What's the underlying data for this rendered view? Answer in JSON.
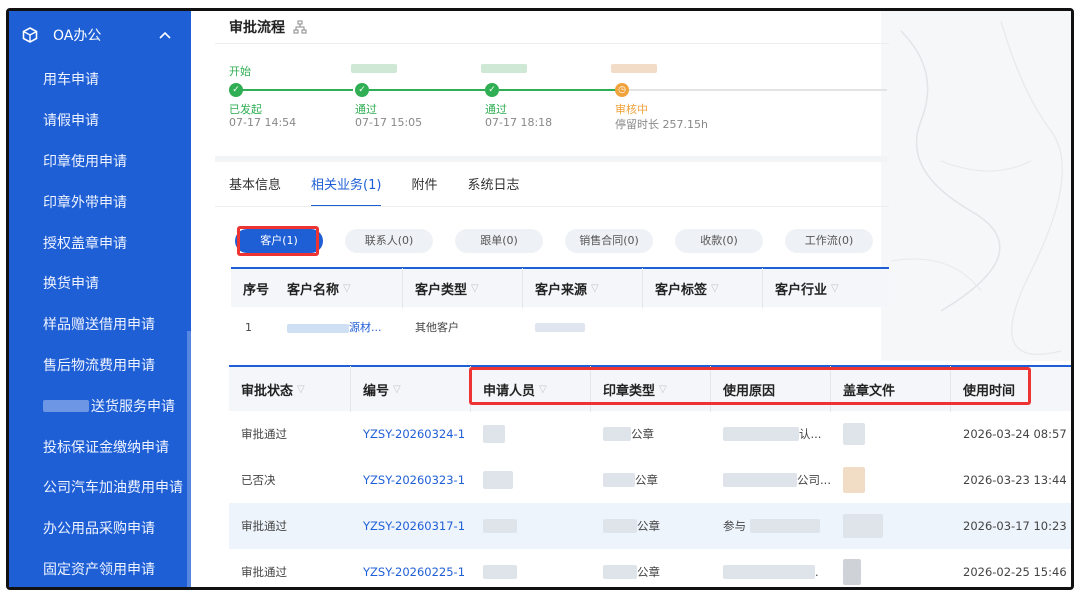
{
  "sidebar": {
    "group_title": "OA办公",
    "items": [
      {
        "label": "用车申请"
      },
      {
        "label": "请假申请"
      },
      {
        "label": "印章使用申请"
      },
      {
        "label": "印章外带申请"
      },
      {
        "label": "授权盖章申请"
      },
      {
        "label": "换货申请"
      },
      {
        "label": "样品赠送借用申请"
      },
      {
        "label": "售后物流费用申请"
      },
      {
        "label": "送货服务申请"
      },
      {
        "label": "投标保证金缴纳申请"
      },
      {
        "label": "公司汽车加油费用申请"
      },
      {
        "label": "办公用品采购申请"
      },
      {
        "label": "固定资产领用申请"
      }
    ]
  },
  "section_title": "审批流程",
  "steps": [
    {
      "top": "开始",
      "status": "已发起",
      "time": "07-17 14:54"
    },
    {
      "top": "",
      "status": "通过",
      "time": "07-17 15:05"
    },
    {
      "top": "",
      "status": "通过",
      "time": "07-17 18:18"
    },
    {
      "top": "",
      "status": "审核中",
      "time": "停留时长 257.15h"
    }
  ],
  "tabs": [
    "基本信息",
    "相关业务(1)",
    "附件",
    "系统日志"
  ],
  "pills": [
    "客户(1)",
    "联系人(0)",
    "跟单(0)",
    "销售合同(0)",
    "收款(0)",
    "工作流(0)"
  ],
  "customer_table": {
    "headers": [
      "序号",
      "客户名称",
      "客户类型",
      "客户来源",
      "客户标签",
      "客户行业"
    ],
    "rows": [
      {
        "index": "1",
        "name": "源材...",
        "type": "其他客户"
      }
    ]
  },
  "approval_table": {
    "headers": [
      "审批状态",
      "编号",
      "申请人员",
      "印章类型",
      "使用原因",
      "盖章文件",
      "使用时间"
    ],
    "rows": [
      {
        "status": "审批通过",
        "code": "YZSY-20260324-1",
        "seal": "公章",
        "reason": "认...",
        "time": "2026-03-24 08:57"
      },
      {
        "status": "已否决",
        "code": "YZSY-20260323-1",
        "seal": "公章",
        "reason": "公司...",
        "time": "2026-03-23 13:44"
      },
      {
        "status": "审批通过",
        "code": "YZSY-20260317-1",
        "seal": "公章",
        "reason": "参与",
        "time": "2026-03-17 10:23"
      },
      {
        "status": "审批通过",
        "code": "YZSY-20260225-1",
        "seal": "公章",
        "reason": ".",
        "time": "2026-02-25 15:46"
      }
    ]
  },
  "colors": {
    "primary": "#1f5fd6",
    "success": "#2fae53",
    "pending": "#f0a23b",
    "highlight": "#e33333"
  }
}
